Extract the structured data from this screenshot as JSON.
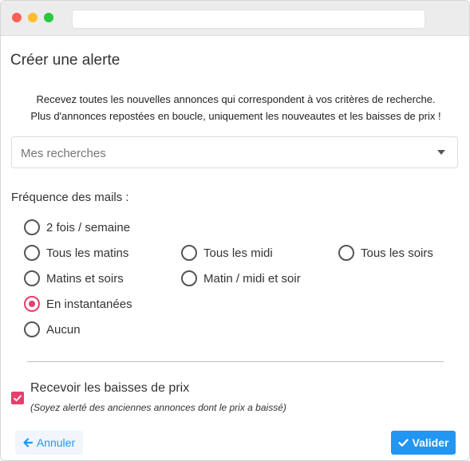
{
  "dialog": {
    "title": "Créer une alerte",
    "intro_line1": "Recevez toutes les nouvelles annonces qui correspondent à vos critères de recherche.",
    "intro_line2": "Plus d'annonces repostées en boucle, uniquement les nouveautes et les baisses de prix !"
  },
  "search_select": {
    "placeholder": "Mes recherches"
  },
  "frequency": {
    "label": "Fréquence des mails :",
    "options": [
      {
        "label": "2 fois / semaine",
        "checked": false
      },
      {
        "label": "Tous les matins",
        "checked": false
      },
      {
        "label": "Tous les midi",
        "checked": false
      },
      {
        "label": "Tous les soirs",
        "checked": false
      },
      {
        "label": "Matins et soirs",
        "checked": false
      },
      {
        "label": "Matin / midi et soir",
        "checked": false
      },
      {
        "label": "En instantanées",
        "checked": true
      },
      {
        "label": "Aucun",
        "checked": false
      }
    ]
  },
  "price_drop": {
    "label": "Recevoir les baisses de prix",
    "hint": "(Soyez alerté des anciennes annonces dont le prix a baissé)",
    "checked": true
  },
  "buttons": {
    "cancel_label": "Annuler",
    "cancel_icon": "arrow-left-icon",
    "validate_label": "Valider",
    "validate_icon": "check-icon"
  },
  "colors": {
    "accent": "#e83e6c",
    "primary": "#2196f3"
  }
}
